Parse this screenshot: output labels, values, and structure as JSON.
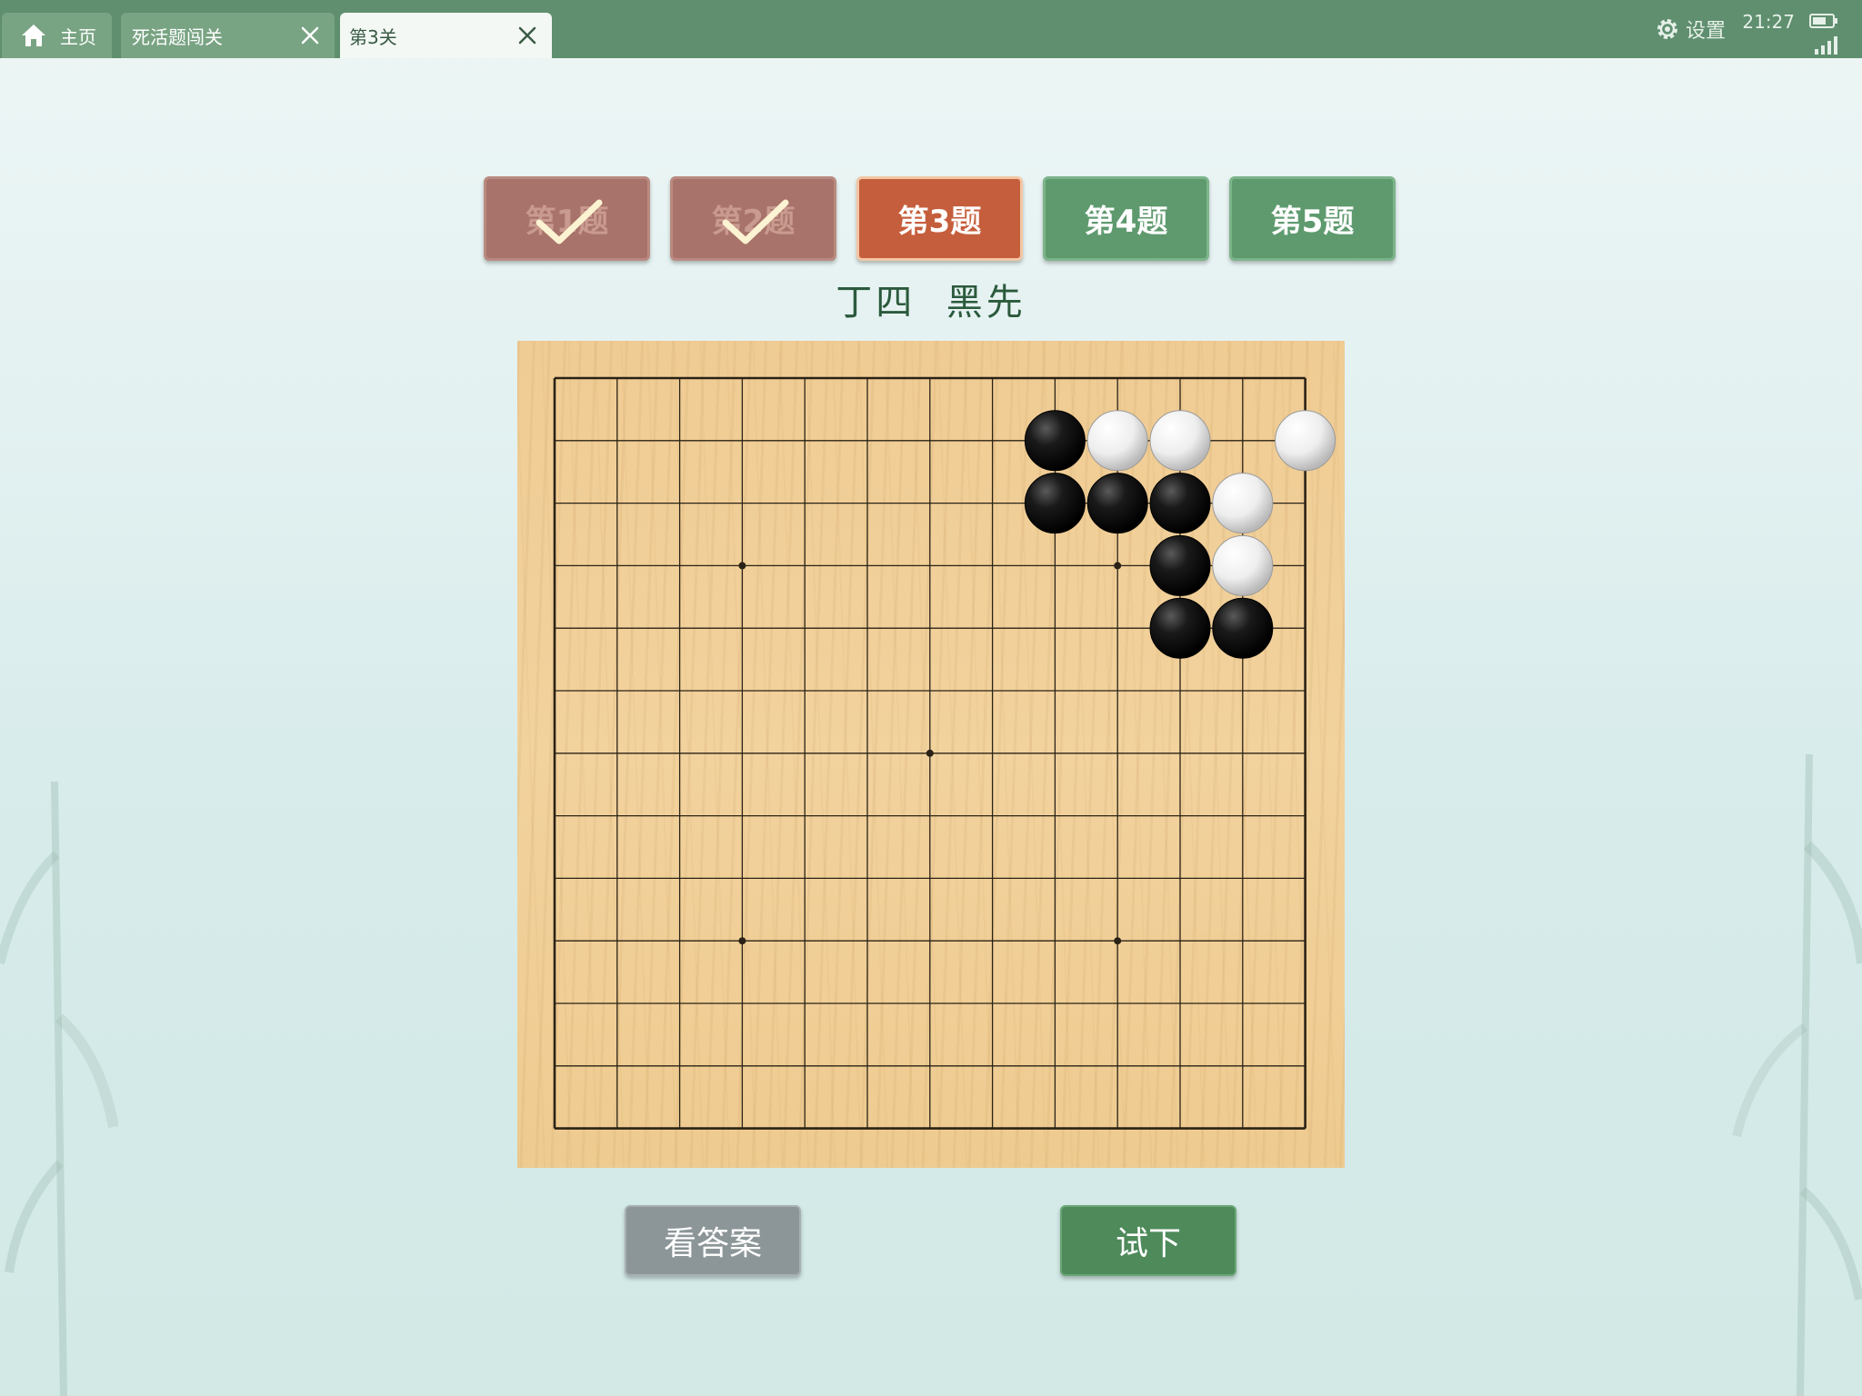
{
  "tabs": [
    {
      "label": "主页",
      "icon": "home-icon",
      "active": false,
      "closable": false
    },
    {
      "label": "死活题闯关",
      "active": false,
      "closable": true
    },
    {
      "label": "第3关",
      "active": true,
      "closable": true
    }
  ],
  "status_bar": {
    "settings_label": "设置",
    "time": "21:27"
  },
  "problems": [
    {
      "label": "第1题",
      "state": "done"
    },
    {
      "label": "第2题",
      "state": "done"
    },
    {
      "label": "第3题",
      "state": "current"
    },
    {
      "label": "第4题",
      "state": "todo"
    },
    {
      "label": "第5题",
      "state": "todo"
    }
  ],
  "problem_title": "丁四  黑先",
  "board": {
    "size": 13,
    "star_points": [
      [
        3,
        3
      ],
      [
        9,
        3
      ],
      [
        6,
        6
      ],
      [
        3,
        9
      ],
      [
        9,
        9
      ]
    ],
    "black_stones": [
      [
        8,
        1
      ],
      [
        8,
        2
      ],
      [
        9,
        2
      ],
      [
        10,
        2
      ],
      [
        10,
        3
      ],
      [
        10,
        4
      ],
      [
        11,
        4
      ]
    ],
    "white_stones": [
      [
        9,
        1
      ],
      [
        10,
        1
      ],
      [
        12,
        1
      ],
      [
        11,
        2
      ],
      [
        11,
        3
      ]
    ]
  },
  "buttons": {
    "answer": "看答案",
    "try": "试下"
  },
  "colors": {
    "topbar": "#5f8f6f",
    "done": "#a8736a",
    "current": "#c55e3c",
    "todo": "#5e9a6e",
    "try": "#4e8a5a",
    "answer": "#8c9698"
  }
}
